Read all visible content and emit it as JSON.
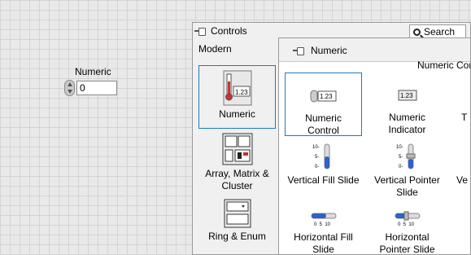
{
  "front_panel": {
    "label": "Numeric",
    "value": "0"
  },
  "controls_palette": {
    "title": "Controls",
    "search_label": "Search",
    "category": "Modern",
    "items": [
      {
        "label": "Numeric",
        "icon": "numeric-palette-icon"
      },
      {
        "label": "Array, Matrix & Cluster",
        "icon": "array-matrix-cluster-icon"
      },
      {
        "label": "Ring & Enum",
        "icon": "ring-enum-icon"
      }
    ]
  },
  "numeric_palette": {
    "title": "Numeric",
    "subheader": "Numeric Cor",
    "items": [
      {
        "label": "Numeric Control"
      },
      {
        "label": "Numeric Indicator"
      },
      {
        "label": "T"
      },
      {
        "label": "Vertical Fill Slide"
      },
      {
        "label": "Vertical Pointer Slide"
      },
      {
        "label": "Ve"
      },
      {
        "label": "Horizontal Fill Slide"
      },
      {
        "label": "Horizontal Pointer Slide"
      }
    ],
    "icon_text": {
      "display": "1.23",
      "tick_top": "10-",
      "tick_mid": "5-",
      "tick_bot": "0-",
      "hscale": "0  5  10"
    }
  },
  "colors": {
    "accent_border": "#1b7bbf",
    "slider_fill": "#2c62c9"
  }
}
